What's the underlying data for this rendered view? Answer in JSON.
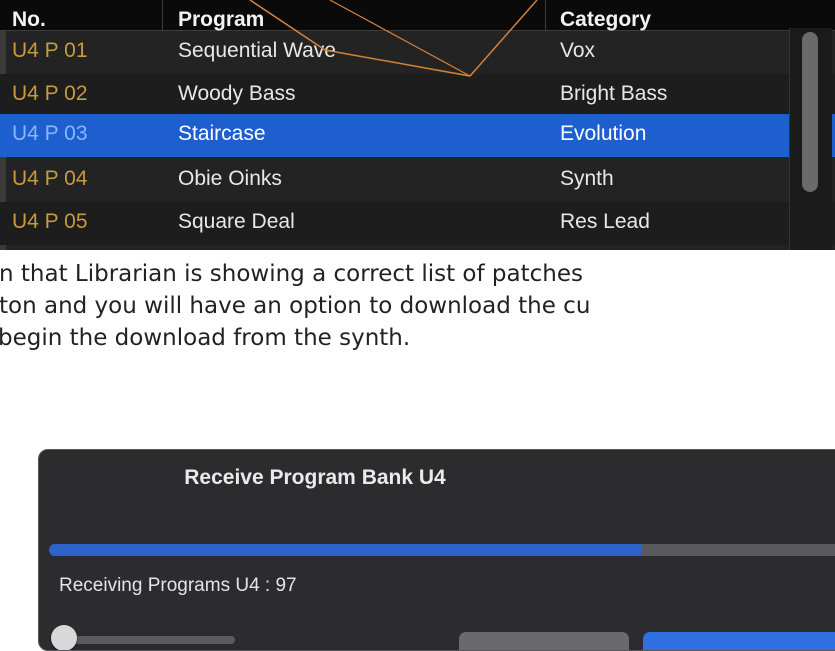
{
  "table": {
    "headers": {
      "number": "No.",
      "program": "Program",
      "category": "Category"
    },
    "rows": [
      {
        "number": "U4 P 01",
        "program": "Sequential Wave",
        "category": "Vox"
      },
      {
        "number": "U4 P 02",
        "program": "Woody Bass",
        "category": "Bright Bass"
      },
      {
        "number": "U4 P 03",
        "program": "Staircase",
        "category": "Evolution",
        "selected": true
      },
      {
        "number": "U4 P 04",
        "program": "Obie Oinks",
        "category": "Synth"
      },
      {
        "number": "U4 P 05",
        "program": "Square Deal",
        "category": "Res Lead"
      }
    ]
  },
  "paragraph": {
    "line1": "n that Librarian is showing a correct list of patches",
    "line2": "ton and you will have an option to download the cu",
    "line3": "begin the download from the synth."
  },
  "dialog": {
    "title": "Receive Program Bank U4",
    "status": "Receiving Programs U4 : 97",
    "progress_fraction": 0.74
  },
  "colors": {
    "selection": "#1e5fd0",
    "number_text": "#c89a3c",
    "progress": "#2e63c9",
    "annotation_line": "#d4823a"
  }
}
